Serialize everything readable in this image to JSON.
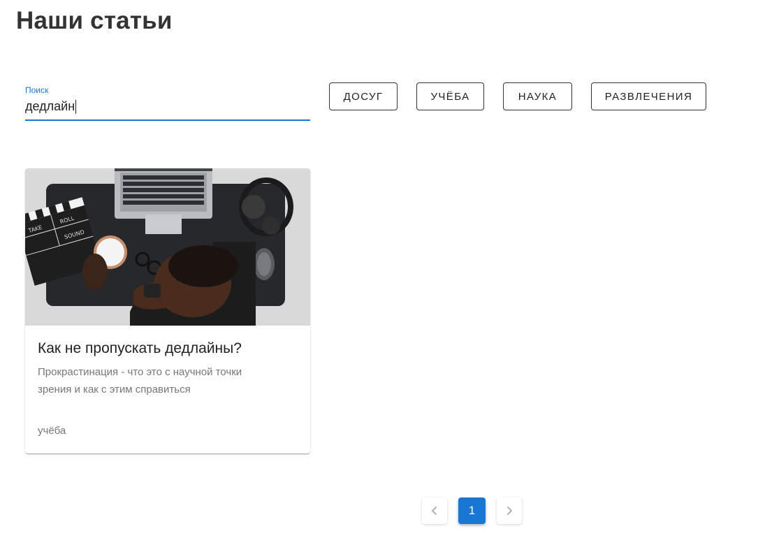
{
  "page": {
    "title": "Наши статьи"
  },
  "search": {
    "label": "Поиск",
    "value": "дедлайн"
  },
  "filters": [
    {
      "label": "ДОСУГ"
    },
    {
      "label": "УЧЁБА"
    },
    {
      "label": "НАУКА"
    },
    {
      "label": "РАЗВЛЕЧЕНИЯ"
    }
  ],
  "articles": [
    {
      "title": "Как не пропускать дедлайны?",
      "description": "Прокрастинация - что это с научной точки зрения и как с этим справиться",
      "tag": "учёба",
      "image": {
        "clapperboard_labels": [
          "TAKE",
          "ROLL",
          "SOUND"
        ]
      }
    }
  ],
  "pagination": {
    "current_page": "1",
    "prev_icon": "chevron-left-icon",
    "next_icon": "chevron-right-icon"
  },
  "colors": {
    "accent": "#1976d2",
    "text_muted": "#777777",
    "title": "#333333"
  }
}
